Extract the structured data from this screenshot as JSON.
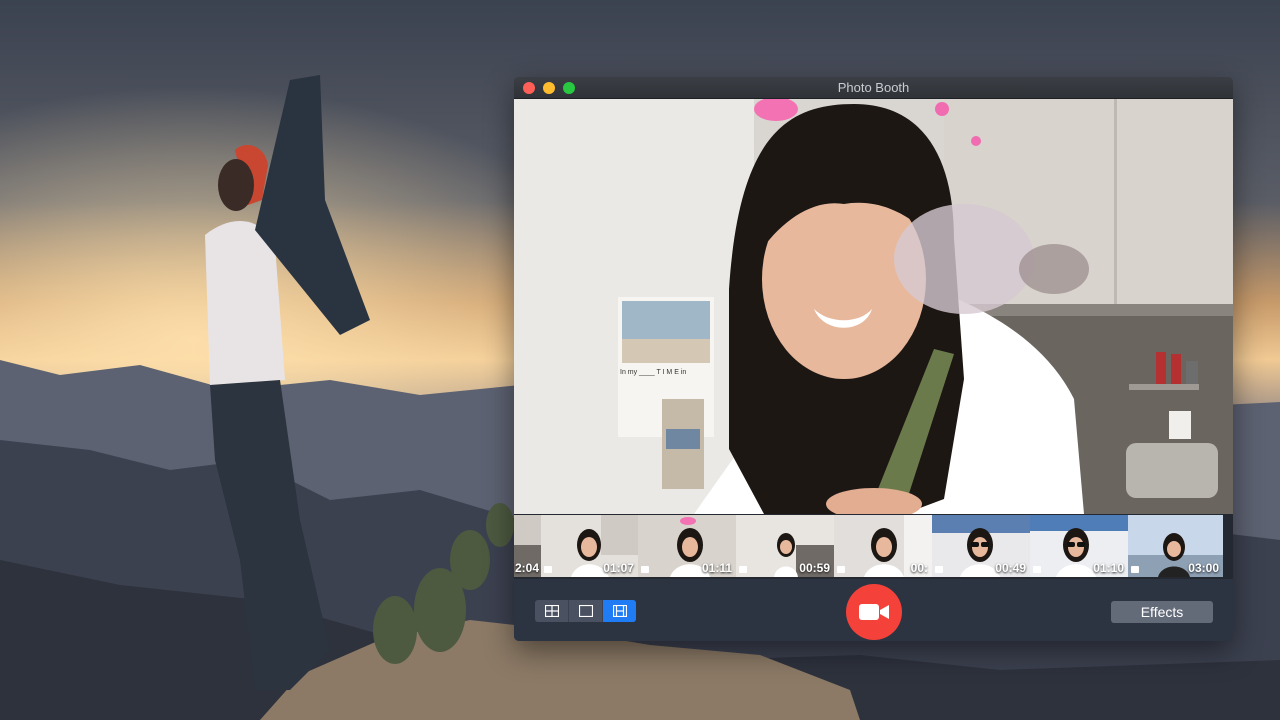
{
  "window": {
    "title": "Photo Booth",
    "controls": [
      "close",
      "minimize",
      "zoom"
    ]
  },
  "preview": {
    "poster_caption": "In my ____ T I M E in"
  },
  "thumbnails": [
    {
      "duration": "2:04"
    },
    {
      "duration": "01:07"
    },
    {
      "duration": "01:11"
    },
    {
      "duration": "00:59"
    },
    {
      "duration": "00:"
    },
    {
      "duration": "00:49"
    },
    {
      "duration": "01:10"
    },
    {
      "duration": "03:00"
    }
  ],
  "toolbar": {
    "view_modes": [
      {
        "name": "grid-view",
        "icon": "grid-icon",
        "selected": false
      },
      {
        "name": "single-view",
        "icon": "square-icon",
        "selected": false
      },
      {
        "name": "filmstrip-view",
        "icon": "film-icon",
        "selected": true
      }
    ],
    "record_icon": "video-camera-icon",
    "effects_label": "Effects"
  },
  "colors": {
    "record": "#f4413a",
    "selected_segment": "#1f7cf5",
    "close": "#fe5f57",
    "minimize": "#febc2e",
    "zoom": "#28c840"
  }
}
